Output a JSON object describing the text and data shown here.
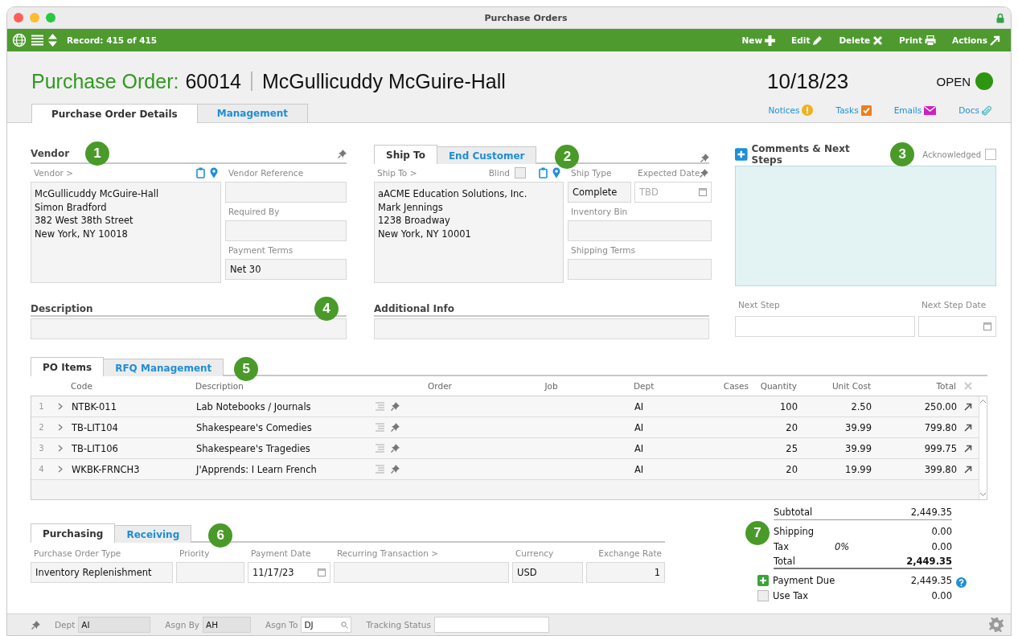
{
  "window": {
    "title": "Purchase Orders"
  },
  "toolbar": {
    "record": "Record: 415 of 415",
    "actions": [
      {
        "label": "New",
        "kind": "plus"
      },
      {
        "label": "Edit",
        "kind": "pencil"
      },
      {
        "label": "Delete",
        "kind": "cross"
      },
      {
        "label": "Print",
        "kind": "printer"
      },
      {
        "label": "Actions",
        "kind": "export"
      }
    ]
  },
  "header": {
    "title_label": "Purchase Order:",
    "number": "60014",
    "name": "McGullicuddy McGuire-Hall",
    "date": "10/18/23",
    "status": "OPEN"
  },
  "main_tabs": [
    {
      "label": "Purchase Order Details",
      "selected": true
    },
    {
      "label": "Management",
      "selected": false
    }
  ],
  "links": [
    {
      "label": "Notices",
      "kind": "notice"
    },
    {
      "label": "Tasks",
      "kind": "task"
    },
    {
      "label": "Emails",
      "kind": "email"
    },
    {
      "label": "Docs",
      "kind": "doc"
    }
  ],
  "vendor": {
    "heading": "Vendor",
    "badge": "1",
    "address_label": "Vendor >",
    "address": [
      "McGullicuddy McGuire-Hall",
      "Simon Bradford",
      "382 West 38th Street",
      "New York, NY 10018"
    ],
    "fields": [
      {
        "label": "Vendor Reference"
      },
      {
        "label": "Required By"
      },
      {
        "label": "Payment Terms",
        "value": "Net 30"
      }
    ]
  },
  "ship": {
    "tabs": [
      {
        "label": "Ship To",
        "selected": true
      },
      {
        "label": "End Customer",
        "selected": false
      }
    ],
    "badge": "2",
    "address_label": "Ship To >",
    "blind_label": "Blind",
    "blind": false,
    "address": [
      "aACME Education Solutions, Inc.",
      "Mark Jennings",
      "1238 Broadway",
      "New York, NY 10001"
    ],
    "ship_type": {
      "label": "Ship Type",
      "value": "Complete"
    },
    "expected_date": {
      "label": "Expected Date",
      "placeholder": "TBD"
    },
    "fields": [
      {
        "label": "Inventory Bin"
      },
      {
        "label": "Shipping Terms"
      }
    ]
  },
  "comments": {
    "heading": "Comments & Next Steps",
    "badge": "3",
    "acknowledged_label": "Acknowledged",
    "acknowledged": false,
    "next_step": {
      "label": "Next Step"
    },
    "next_step_date": {
      "label": "Next Step Date"
    }
  },
  "description": {
    "heading": "Description",
    "badge": "4"
  },
  "additional_info": {
    "heading": "Additional Info"
  },
  "items": {
    "tabs": [
      {
        "label": "PO Items",
        "selected": true
      },
      {
        "label": "RFQ Management",
        "selected": false
      }
    ],
    "badge": "5",
    "columns": [
      "Code",
      "Description",
      "Order",
      "Job",
      "Dept",
      "Cases",
      "Quantity",
      "Unit Cost",
      "Total"
    ],
    "rows": [
      {
        "index": "1",
        "code": "NTBK-011",
        "description": "Lab Notebooks / Journals",
        "dept": "AI",
        "quantity": "100",
        "unit_cost": "2.50",
        "total": "250.00"
      },
      {
        "index": "2",
        "code": "TB-LIT104",
        "description": "Shakespeare's Comedies",
        "dept": "AI",
        "quantity": "20",
        "unit_cost": "39.99",
        "total": "799.80"
      },
      {
        "index": "3",
        "code": "TB-LIT106",
        "description": "Shakespeare's Tragedies",
        "dept": "AI",
        "quantity": "25",
        "unit_cost": "39.99",
        "total": "999.75"
      },
      {
        "index": "4",
        "code": "WKBK-FRNCH3",
        "description": "J'Apprends: I Learn French",
        "dept": "AI",
        "quantity": "20",
        "unit_cost": "19.99",
        "total": "399.80"
      }
    ]
  },
  "purchasing": {
    "tabs": [
      {
        "label": "Purchasing",
        "selected": true
      },
      {
        "label": "Receiving",
        "selected": false
      }
    ],
    "badge": "6",
    "fields": [
      {
        "label": "Purchase Order Type",
        "value": "Inventory Replenishment",
        "kind": "text"
      },
      {
        "label": "Priority",
        "kind": "text"
      },
      {
        "label": "Payment Date",
        "value": "11/17/23",
        "kind": "date"
      },
      {
        "label": "Recurring Transaction >",
        "kind": "text"
      },
      {
        "label": "Currency",
        "value": "USD",
        "kind": "text"
      },
      {
        "label": "Exchange Rate",
        "value": "1",
        "kind": "number"
      }
    ]
  },
  "totals": {
    "badge": "7",
    "subtotal": {
      "label": "Subtotal",
      "value": "2,449.35"
    },
    "shipping": {
      "label": "Shipping",
      "value": "0.00"
    },
    "tax": {
      "label": "Tax",
      "rate": "0%",
      "value": "0.00"
    },
    "total": {
      "label": "Total",
      "value": "2,449.35"
    },
    "payment_due": {
      "label": "Payment Due",
      "value": "2,449.35"
    },
    "use_tax": {
      "label": "Use Tax",
      "value": "0.00",
      "checked": false
    }
  },
  "footer": {
    "fields": [
      {
        "label": "Dept",
        "value": "AI",
        "kind": "text"
      },
      {
        "label": "Asgn By",
        "value": "AH",
        "kind": "text"
      },
      {
        "label": "Asgn To",
        "value": "DJ",
        "kind": "lookup"
      },
      {
        "label": "Tracking Status",
        "kind": "wide"
      }
    ]
  }
}
